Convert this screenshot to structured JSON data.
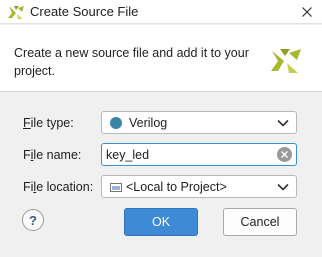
{
  "window": {
    "title": "Create Source File"
  },
  "header": {
    "description": "Create a new source file and add it to your project."
  },
  "form": {
    "file_type": {
      "label_mnemonic": "F",
      "label_rest": "ile type:",
      "value": "Verilog"
    },
    "file_name": {
      "label_pre": "F",
      "label_mnemonic": "i",
      "label_rest": "le name:",
      "value": "key_led"
    },
    "file_location": {
      "label_pre": "Fi",
      "label_mnemonic": "l",
      "label_rest": "e location:",
      "value": "<Local to Project>"
    }
  },
  "buttons": {
    "help": "?",
    "ok": "OK",
    "cancel": "Cancel"
  },
  "colors": {
    "accent": "#3f8ad6",
    "verilog_dot": "#3a84a6",
    "logo_green": "#a7b82b"
  }
}
